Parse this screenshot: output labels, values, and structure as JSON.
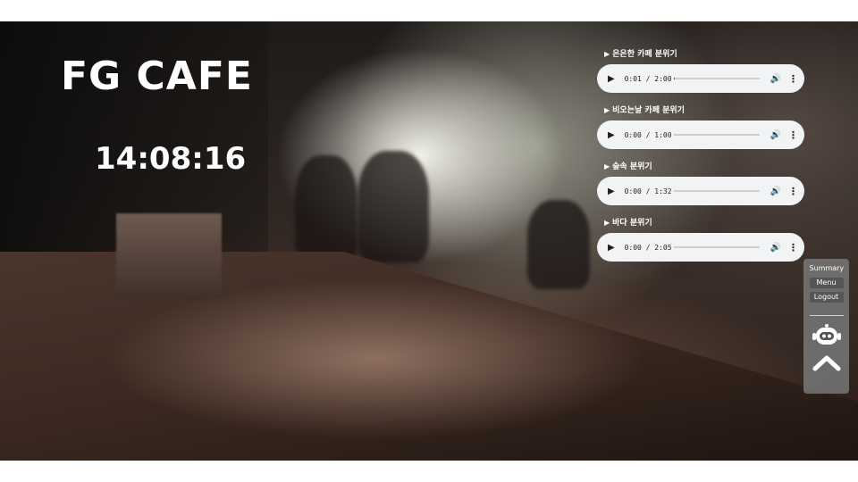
{
  "brand": {
    "title": "FG CAFE"
  },
  "clock": {
    "time": "14:08:16"
  },
  "tracks": [
    {
      "title": "은은한 카페 분위기",
      "time": "0:01 / 2:00",
      "progress": 0.01
    },
    {
      "title": "비오는날 카페 분위기",
      "time": "0:00 / 1:00",
      "progress": 0.0
    },
    {
      "title": "숲속 분위기",
      "time": "0:00 / 1:32",
      "progress": 0.0
    },
    {
      "title": "바다 분위기",
      "time": "0:00 / 2:05",
      "progress": 0.0
    }
  ],
  "side_panel": {
    "summary_label": "Summary",
    "menu_label": "Menu",
    "logout_label": "Logout",
    "icons": [
      "chatbot-icon",
      "chevron-up-icon"
    ]
  },
  "colors": {
    "player_bg": "#f1f3f4",
    "panel_bg": "#787878",
    "text": "#ffffff"
  }
}
